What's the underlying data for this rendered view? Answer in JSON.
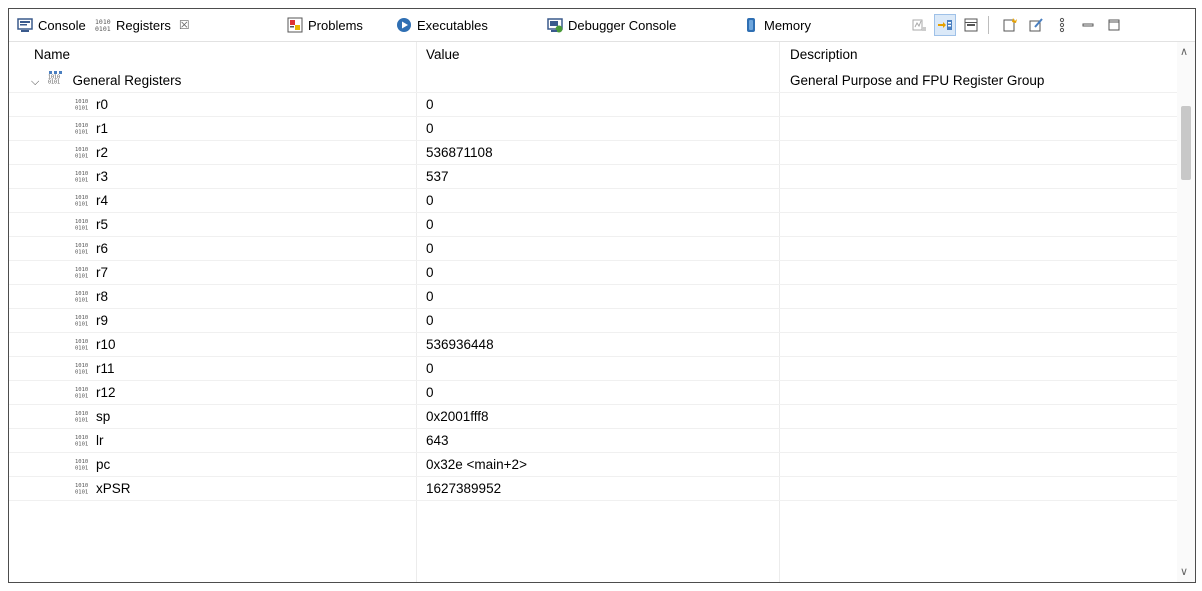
{
  "tabs": [
    {
      "label": "Console",
      "icon": "console-icon"
    },
    {
      "label": "Registers",
      "icon": "registers-icon",
      "active": true
    },
    {
      "label": "Problems",
      "icon": "problems-icon"
    },
    {
      "label": "Executables",
      "icon": "executables-icon"
    },
    {
      "label": "Debugger Console",
      "icon": "debugger-console-icon"
    },
    {
      "label": "Memory",
      "icon": "memory-icon"
    }
  ],
  "registers_close_glyph": "☒",
  "columns": {
    "name": "Name",
    "value": "Value",
    "description": "Description"
  },
  "group": {
    "name": "General Registers",
    "value": "",
    "description": "General Purpose and FPU Register Group"
  },
  "registers": [
    {
      "name": "r0",
      "value": "0"
    },
    {
      "name": "r1",
      "value": "0"
    },
    {
      "name": "r2",
      "value": "536871108"
    },
    {
      "name": "r3",
      "value": "537"
    },
    {
      "name": "r4",
      "value": "0"
    },
    {
      "name": "r5",
      "value": "0"
    },
    {
      "name": "r6",
      "value": "0"
    },
    {
      "name": "r7",
      "value": "0"
    },
    {
      "name": "r8",
      "value": "0"
    },
    {
      "name": "r9",
      "value": "0"
    },
    {
      "name": "r10",
      "value": "536936448"
    },
    {
      "name": "r11",
      "value": "0"
    },
    {
      "name": "r12",
      "value": "0"
    },
    {
      "name": "sp",
      "value": "0x2001fff8"
    },
    {
      "name": "lr",
      "value": "643"
    },
    {
      "name": "pc",
      "value": "0x32e <main+2>"
    },
    {
      "name": "xPSR",
      "value": "1627389952"
    }
  ],
  "colors": {
    "selected_button_bg": "#dbe9f8",
    "border": "#4d4d4d"
  }
}
